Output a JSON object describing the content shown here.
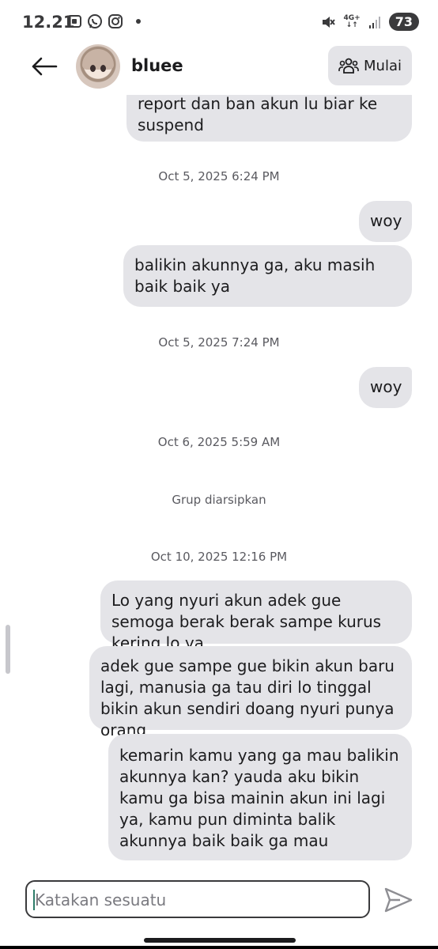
{
  "status_bar": {
    "time": "12.21",
    "network": "4G+",
    "battery": "73"
  },
  "header": {
    "username": "bluee",
    "start_label": "Mulai"
  },
  "messages": [
    {
      "text": "report dan ban akun lu biar ke suspend"
    },
    {
      "timestamp": "Oct 5, 2025 6:24 PM"
    },
    {
      "text": "woy"
    },
    {
      "text": "balikin akunnya ga, aku masih baik baik ya"
    },
    {
      "timestamp": "Oct 5, 2025 7:24 PM"
    },
    {
      "text": "woy"
    },
    {
      "timestamp": "Oct 6, 2025 5:59 AM"
    },
    {
      "system": "Grup diarsipkan"
    },
    {
      "timestamp": "Oct 10, 2025 12:16 PM"
    },
    {
      "text": "Lo yang nyuri akun adek gue semoga berak berak sampe kurus kering lo ya"
    },
    {
      "text": "adek gue sampe gue bikin akun baru lagi, manusia ga tau diri lo tinggal bikin akun sendiri doang nyuri punya orang"
    },
    {
      "text": "kemarin kamu yang ga mau balikin akunnya kan? yauda aku bikin kamu ga bisa mainin akun ini lagi ya, kamu pun diminta balik akunnya baik baik ga mau"
    }
  ],
  "composer": {
    "placeholder": "Katakan sesuatu"
  },
  "icons": {
    "back": "arrow-left-icon",
    "people": "people-group-icon",
    "send": "send-icon"
  }
}
